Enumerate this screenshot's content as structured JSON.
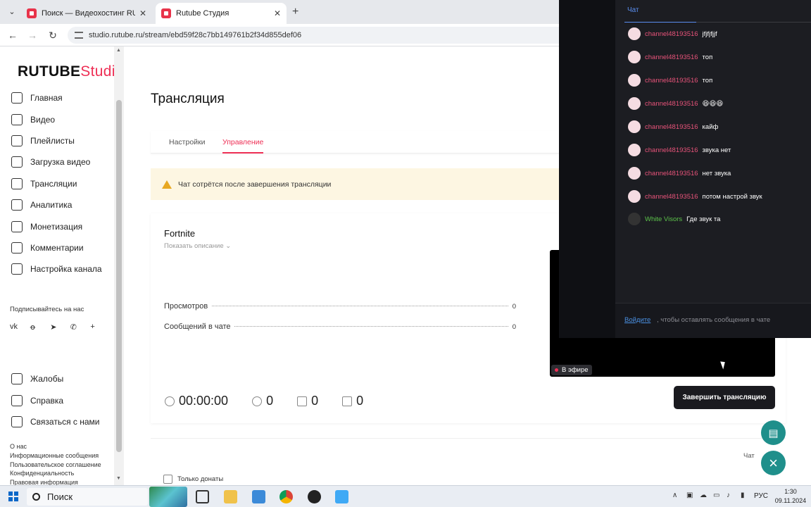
{
  "browser": {
    "tabs": [
      {
        "title": "Поиск — Видеохостинг RUTUBE",
        "active": false
      },
      {
        "title": "Rutube Студия",
        "active": true
      }
    ],
    "close_glyph": "✕",
    "new_tab_glyph": "+",
    "url": "studio.rutube.ru/stream/ebd59f28c7bb149761b2f34d855def06"
  },
  "brand": {
    "name": "RUTUBE",
    "suffix": "Studio",
    "accent": "#ee2f55"
  },
  "sidebar": {
    "items": [
      {
        "label": "Главная",
        "icon": "home-icon"
      },
      {
        "label": "Видео",
        "icon": "video-icon"
      },
      {
        "label": "Плейлисты",
        "icon": "playlist-icon"
      },
      {
        "label": "Загрузка видео",
        "icon": "upload-icon"
      },
      {
        "label": "Трансляции",
        "icon": "broadcast-icon"
      },
      {
        "label": "Аналитика",
        "icon": "analytics-icon"
      },
      {
        "label": "Монетизация",
        "icon": "money-icon"
      },
      {
        "label": "Комментарии",
        "icon": "comments-icon"
      },
      {
        "label": "Настройка канала",
        "icon": "wand-icon"
      }
    ],
    "follow_label": "Подписывайтесь на нас",
    "socials": [
      "vk-icon",
      "ok-icon",
      "telegram-icon",
      "viber-icon",
      "plus-icon"
    ],
    "bottom_items": [
      {
        "label": "Жалобы",
        "icon": "flag-icon"
      },
      {
        "label": "Справка",
        "icon": "help-icon"
      },
      {
        "label": "Связаться с нами",
        "icon": "contact-icon"
      }
    ],
    "footer_links": [
      "О нас",
      "Информационные сообщения",
      "Пользовательское соглашение",
      "Конфиденциальность",
      "Правовая информация"
    ]
  },
  "main": {
    "title": "Трансляция",
    "tabs": [
      {
        "label": "Настройки"
      },
      {
        "label": "Управление"
      }
    ],
    "warning": "Чат сотрётся после завершения трансляции",
    "stream": {
      "name": "Fortnite",
      "show_description": "Показать описание",
      "stats": [
        {
          "label": "Просмотров",
          "value": "0"
        },
        {
          "label": "Сообщений в чате",
          "value": "0"
        }
      ],
      "counters": {
        "duration": "00:00:00",
        "viewers": "0",
        "likes": "0",
        "dislikes": "0"
      },
      "live_badge": "В эфире",
      "end_button": "Завершить трансляцию"
    },
    "only_donates": "Только донаты",
    "chat_label": "Чат"
  },
  "chat": {
    "tab": "Чат",
    "messages": [
      {
        "user": "channel48193516",
        "text": "jfjfjfjjf",
        "color": "#e8537a"
      },
      {
        "user": "channel48193516",
        "text": "топ",
        "color": "#e8537a"
      },
      {
        "user": "channel48193516",
        "text": "топ",
        "color": "#e8537a"
      },
      {
        "user": "channel48193516",
        "text": "😆😆😆",
        "color": "#e8537a"
      },
      {
        "user": "channel48193516",
        "text": "кайф",
        "color": "#e8537a"
      },
      {
        "user": "channel48193516",
        "text": "звука нет",
        "color": "#e8537a"
      },
      {
        "user": "channel48193516",
        "text": "нет звука",
        "color": "#e8537a"
      },
      {
        "user": "channel48193516",
        "text": "потом настрой звук",
        "color": "#e8537a"
      },
      {
        "user": "White Visors",
        "text": "Где звук та",
        "color": "#5cc24a"
      }
    ],
    "login_link": "Войдите",
    "login_hint": ", чтобы оставлять сообщения в чате"
  },
  "taskbar": {
    "search": "Поиск",
    "language": "РУС",
    "time": "1:30",
    "date": "09.11.2024"
  }
}
